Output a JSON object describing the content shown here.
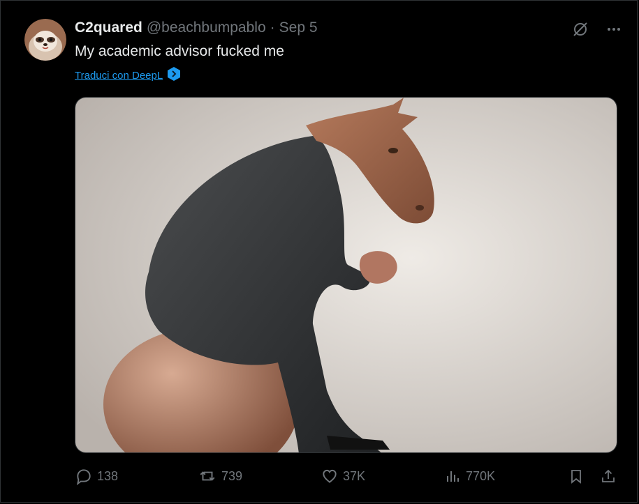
{
  "tweet": {
    "display_name": "C2quared",
    "handle": "@beachbumpablo",
    "separator": "·",
    "date": "Sep 5",
    "text": "My academic advisor fucked me",
    "translate_label": "Traduci con DeepL"
  },
  "media": {
    "icon": "image"
  },
  "actions": {
    "replies": "138",
    "reposts": "739",
    "likes": "37K",
    "views": "770K"
  },
  "icons": {
    "top": [
      "grok-icon",
      "more-icon"
    ],
    "bottom": [
      "reply-icon",
      "repost-icon",
      "like-icon",
      "views-icon",
      "bookmark-icon",
      "share-icon"
    ]
  },
  "colors": {
    "background": "#000000",
    "text": "#e7e9ea",
    "muted": "#71767b",
    "link": "#1d9bf0",
    "border": "#2f3336"
  }
}
